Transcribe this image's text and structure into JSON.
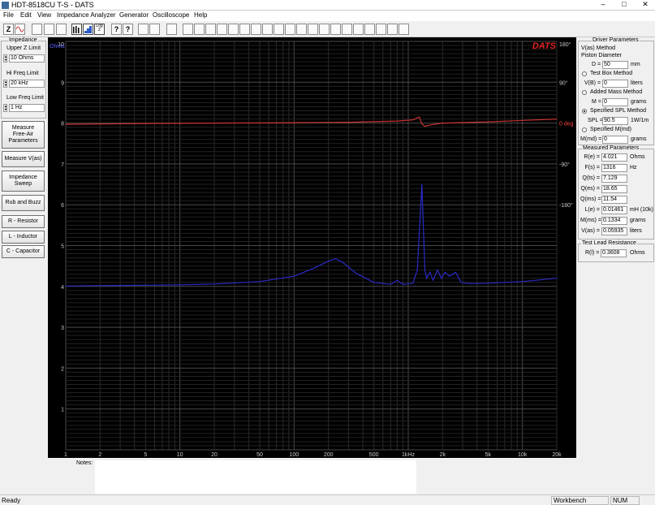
{
  "window": {
    "title": "HDT-8518CU T-S  -  DATS",
    "minimize": "–",
    "maximize": "□",
    "close": "✕"
  },
  "menu": [
    "File",
    "Edit",
    "View",
    "Impedance Analyzer",
    "Generator",
    "Oscilloscope",
    "Help"
  ],
  "toolbar": {
    "impedance_icon": "Z",
    "logz_label": "Log Z",
    "help_icon": "?",
    "whatsthis_icon": "?"
  },
  "left_panel": {
    "impedance_title": "Impedance",
    "upper_z": {
      "label": "Upper Z Limit",
      "value": "10 Ohms"
    },
    "hi_freq": {
      "label": "Hi Freq Limit",
      "value": "20 kHz"
    },
    "low_freq": {
      "label": "Low Freq Limit",
      "value": "1 Hz"
    },
    "buttons": [
      "Measure\nFree-Air\nParameters",
      "Measure V(as)",
      "Impedance\nSweep",
      "Rub and Buzz",
      "R - Resistor",
      "L - Inductor",
      "C - Capacitor"
    ]
  },
  "chart_data": {
    "type": "line",
    "brand": "DATS",
    "y_unit": "Ohms",
    "ylim": [
      0,
      10
    ],
    "y_ticks": [
      "10",
      "9",
      "8",
      "7",
      "6",
      "5",
      "4",
      "3",
      "2",
      "1"
    ],
    "phase_ticks": [
      "180°",
      "90°",
      "0 deg",
      "-90°",
      "-180°"
    ],
    "x_scale": "log",
    "xlim": [
      1,
      20000
    ],
    "x_tick_labels": [
      {
        "v": 1,
        "t": "1"
      },
      {
        "v": 2,
        "t": "2"
      },
      {
        "v": 5,
        "t": "5"
      },
      {
        "v": 10,
        "t": "10"
      },
      {
        "v": 20,
        "t": "20"
      },
      {
        "v": 50,
        "t": "50"
      },
      {
        "v": 100,
        "t": "100"
      },
      {
        "v": 200,
        "t": "200"
      },
      {
        "v": 500,
        "t": "500"
      },
      {
        "v": 1000,
        "t": "1kHz"
      },
      {
        "v": 2000,
        "t": "2k"
      },
      {
        "v": 5000,
        "t": "5k"
      },
      {
        "v": 10000,
        "t": "10k"
      },
      {
        "v": 20000,
        "t": "20k"
      }
    ],
    "grid": true,
    "colors": {
      "impedance": "#2a2ac8",
      "phase": "#c83232",
      "brand": "#e02020",
      "axis_text": "#c8c8c8"
    },
    "series": [
      {
        "values": [
          [
            1,
            4.01
          ],
          [
            2,
            4.02
          ],
          [
            5,
            4.03
          ],
          [
            10,
            4.04
          ],
          [
            20,
            4.06
          ],
          [
            50,
            4.12
          ],
          [
            100,
            4.25
          ],
          [
            150,
            4.45
          ],
          [
            200,
            4.62
          ],
          [
            230,
            4.68
          ],
          [
            270,
            4.58
          ],
          [
            350,
            4.32
          ],
          [
            500,
            4.1
          ],
          [
            700,
            4.05
          ],
          [
            800,
            4.15
          ],
          [
            900,
            4.05
          ],
          [
            1100,
            4.08
          ],
          [
            1200,
            4.4
          ],
          [
            1260,
            5.5
          ],
          [
            1316,
            6.5
          ],
          [
            1350,
            5.6
          ],
          [
            1400,
            4.4
          ],
          [
            1450,
            4.2
          ],
          [
            1550,
            4.35
          ],
          [
            1650,
            4.15
          ],
          [
            1800,
            4.4
          ],
          [
            1950,
            4.2
          ],
          [
            2100,
            4.35
          ],
          [
            2300,
            4.25
          ],
          [
            2600,
            4.35
          ],
          [
            2900,
            4.1
          ],
          [
            3500,
            4.07
          ],
          [
            5000,
            4.08
          ],
          [
            10000,
            4.12
          ],
          [
            20000,
            4.2
          ]
        ]
      },
      {
        "values": [
          [
            1,
            7.97
          ],
          [
            5,
            7.99
          ],
          [
            20,
            8.0
          ],
          [
            100,
            8.01
          ],
          [
            300,
            8.02
          ],
          [
            800,
            8.05
          ],
          [
            1100,
            8.08
          ],
          [
            1250,
            8.15
          ],
          [
            1316,
            7.98
          ],
          [
            1400,
            7.92
          ],
          [
            1600,
            7.96
          ],
          [
            2000,
            8.0
          ],
          [
            5000,
            8.03
          ],
          [
            20000,
            8.1
          ]
        ]
      }
    ]
  },
  "right_panel": {
    "driver_title": "Driver Parameters",
    "vas_method": "V(as) Method",
    "piston_label": "Piston Diameter",
    "d_label": "D =",
    "d_value": "50",
    "d_unit": "mm",
    "test_box": "Test Box Method",
    "vb_label": "V(B) =",
    "vb_value": "0",
    "vb_unit": "liters",
    "added_mass": "Added Mass Method",
    "m_label": "M =",
    "m_value": "0",
    "m_unit": "grams",
    "spl_method": "Specified SPL Method",
    "spl_label": "SPL =",
    "spl_value": "90.5",
    "spl_unit": "1W/1m",
    "spec_mmd": "Specified M(md)",
    "mmd_label": "M(md) =",
    "mmd_value": "0",
    "mmd_unit": "grams",
    "measured_title": "Measured Parameters",
    "params": [
      {
        "label": "R(e) =",
        "value": "4.021",
        "unit": "Ohms"
      },
      {
        "label": "F(s) =",
        "value": "1316",
        "unit": "Hz"
      },
      {
        "label": "Q(ts) =",
        "value": "7.129",
        "unit": ""
      },
      {
        "label": "Q(es) =",
        "value": "18.65",
        "unit": ""
      },
      {
        "label": "Q(ms) =",
        "value": "11.54",
        "unit": ""
      },
      {
        "label": "L(e) =",
        "value": "0.01461",
        "unit": "mH (10k)"
      },
      {
        "label": "M(ms) =",
        "value": "0.1334",
        "unit": "grams"
      },
      {
        "label": "V(as) =",
        "value": "0.05935",
        "unit": "liters"
      }
    ],
    "lead_title": "Test Lead Resistance",
    "lead_label": "R(l) =",
    "lead_value": "0.3608",
    "lead_unit": "Ohms"
  },
  "notes": {
    "label": "Notes:"
  },
  "status": {
    "left": "Ready",
    "workbench": "Workbench",
    "num": "NUM"
  }
}
